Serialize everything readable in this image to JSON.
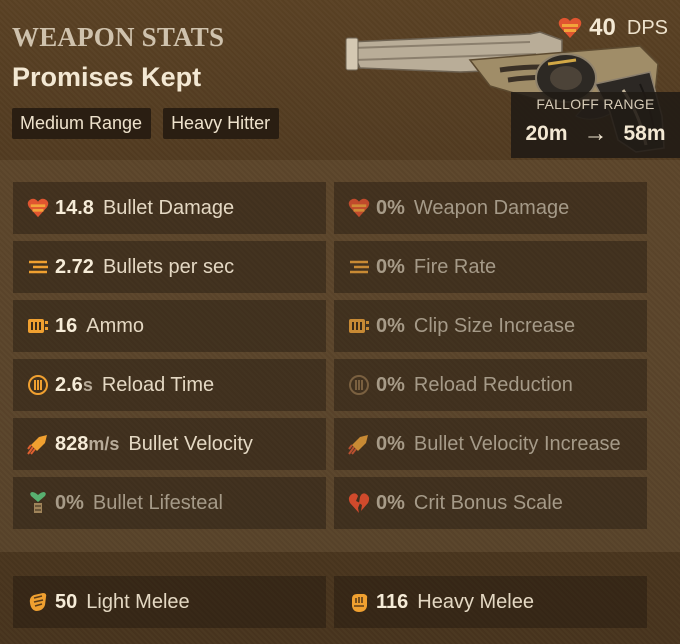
{
  "header": {
    "section_title": "WEAPON STATS",
    "weapon_name": "Promises Kept",
    "tags": [
      "Medium Range",
      "Heavy Hitter"
    ],
    "dps_value": "40",
    "dps_label": "DPS",
    "falloff_title": "FALLOFF RANGE",
    "falloff_start": "20m",
    "falloff_arrow": "→",
    "falloff_end": "58m"
  },
  "stats_left": [
    {
      "icon": "heart-bullet-icon",
      "value": "14.8",
      "unit": "",
      "label": "Bullet Damage"
    },
    {
      "icon": "fire-rate-icon",
      "value": "2.72",
      "unit": "",
      "label": "Bullets per sec"
    },
    {
      "icon": "ammo-icon",
      "value": "16",
      "unit": "",
      "label": "Ammo"
    },
    {
      "icon": "reload-icon",
      "value": "2.6",
      "unit": "s",
      "label": "Reload Time"
    },
    {
      "icon": "velocity-icon",
      "value": "828",
      "unit": "m/s",
      "label": "Bullet Velocity"
    },
    {
      "icon": "lifesteal-icon",
      "value": "0%",
      "unit": "",
      "label": "Bullet Lifesteal"
    }
  ],
  "stats_right": [
    {
      "icon": "weapon-damage-icon",
      "value": "0%",
      "label": "Weapon Damage"
    },
    {
      "icon": "fire-rate-icon",
      "value": "0%",
      "label": "Fire Rate"
    },
    {
      "icon": "clip-size-icon",
      "value": "0%",
      "label": "Clip Size Increase"
    },
    {
      "icon": "reload-reduction-icon",
      "value": "0%",
      "label": "Reload Reduction"
    },
    {
      "icon": "velocity-icon",
      "value": "0%",
      "label": "Bullet Velocity Increase"
    },
    {
      "icon": "crit-icon",
      "value": "0%",
      "label": "Crit Bonus Scale"
    }
  ],
  "melee": [
    {
      "icon": "light-melee-icon",
      "value": "50",
      "label": "Light Melee"
    },
    {
      "icon": "heavy-melee-icon",
      "value": "116",
      "label": "Heavy Melee"
    }
  ],
  "colors": {
    "accent_orange": "#f0a030",
    "heart_red": "#e05530",
    "lifesteal_green": "#58b070"
  }
}
